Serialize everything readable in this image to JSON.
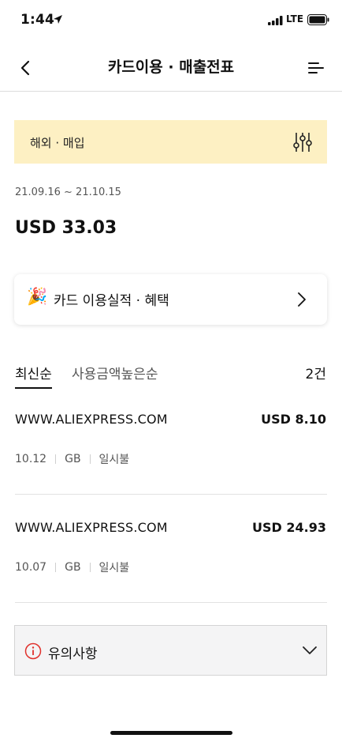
{
  "status_bar": {
    "time": "1:44",
    "network": "LTE"
  },
  "header": {
    "title": "카드이용 · 매출전표"
  },
  "filter": {
    "label": "해외 · 매입"
  },
  "summary": {
    "date_range": "21.09.16 ~ 21.10.15",
    "total": "USD 33.03"
  },
  "perf": {
    "emoji": "🎉",
    "label": "카드 이용실적 · 혜택"
  },
  "sort": {
    "latest": "최신순",
    "amount": "사용금액높은순",
    "count": "2건"
  },
  "transactions": [
    {
      "merchant": "WWW.ALIEXPRESS.COM",
      "amount": "USD 8.10",
      "date": "10.12",
      "country": "GB",
      "type": "일시불"
    },
    {
      "merchant": "WWW.ALIEXPRESS.COM",
      "amount": "USD 24.93",
      "date": "10.07",
      "country": "GB",
      "type": "일시불"
    }
  ],
  "notice": {
    "label": "유의사항"
  },
  "colors": {
    "filter_bg": "#fdf0c3",
    "notice_icon": "#e0312c"
  }
}
